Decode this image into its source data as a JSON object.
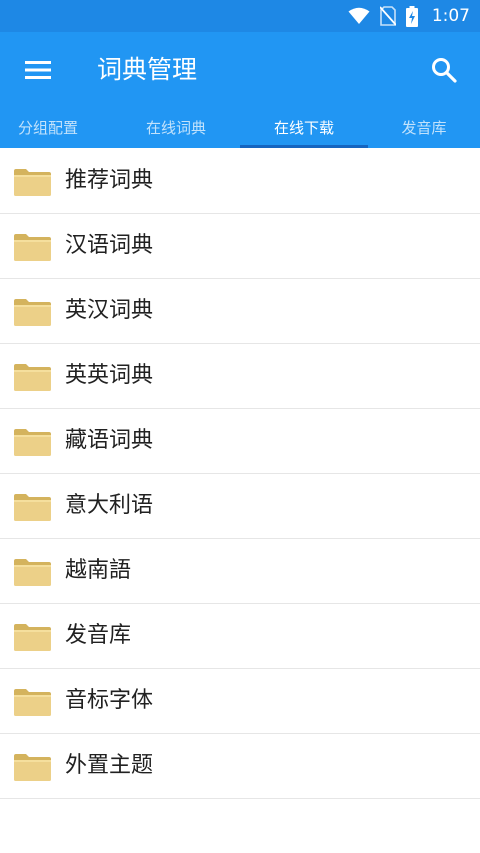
{
  "status_bar": {
    "time": "1:07",
    "icons": [
      "wifi-icon",
      "no-sim-icon",
      "battery-charging-icon"
    ],
    "color": "#1e88e5"
  },
  "app_bar": {
    "title": "词典管理",
    "menu_icon": "menu-icon",
    "search_icon": "search-icon",
    "color": "#2196f3"
  },
  "tabs": [
    {
      "label": "分组配置",
      "active": false
    },
    {
      "label": "在线词典",
      "active": false
    },
    {
      "label": "在线下载",
      "active": true
    },
    {
      "label": "发音库",
      "active": false
    }
  ],
  "list": {
    "item_icon": "folder-icon",
    "items": [
      {
        "label": "推荐词典"
      },
      {
        "label": "汉语词典"
      },
      {
        "label": "英汉词典"
      },
      {
        "label": "英英词典"
      },
      {
        "label": "藏语词典"
      },
      {
        "label": "意大利语"
      },
      {
        "label": "越南語"
      },
      {
        "label": "发音库"
      },
      {
        "label": "音标字体"
      },
      {
        "label": "外置主题"
      }
    ]
  }
}
